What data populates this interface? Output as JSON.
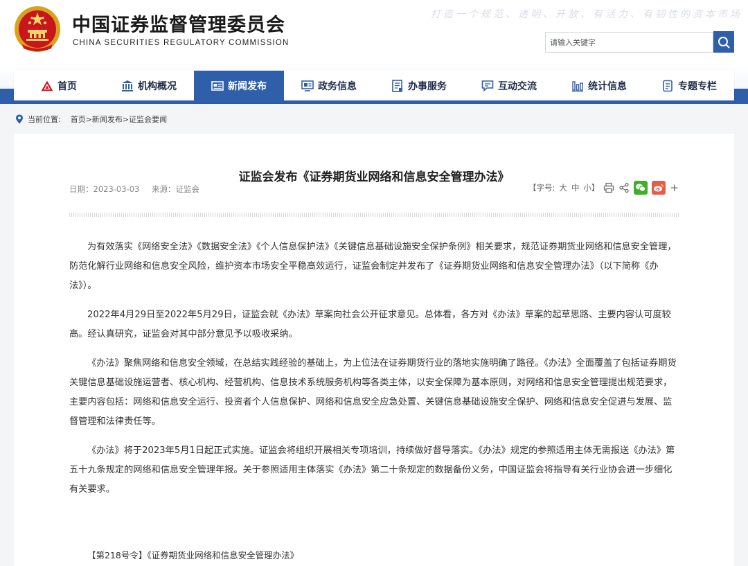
{
  "header": {
    "title_cn": "中国证券监督管理委员会",
    "title_en": "CHINA SECURITIES REGULATORY COMMISSION",
    "slogan": "打造一个规范、透明、开放、有活力、有韧性的资本市场",
    "search_placeholder": "请输入关键字",
    "brand_color": "#2e5fa8"
  },
  "nav": {
    "items": [
      {
        "label": "首页",
        "icon": "home-logo-icon"
      },
      {
        "label": "机构概况",
        "icon": "building-icon"
      },
      {
        "label": "新闻发布",
        "icon": "newspaper-icon",
        "active": true
      },
      {
        "label": "政务信息",
        "icon": "monitor-icon"
      },
      {
        "label": "办事服务",
        "icon": "document-list-icon"
      },
      {
        "label": "互动交流",
        "icon": "chat-icon"
      },
      {
        "label": "统计信息",
        "icon": "bar-chart-icon"
      },
      {
        "label": "专题专栏",
        "icon": "column-doc-icon"
      }
    ]
  },
  "breadcrumb": {
    "label": "当前位置:",
    "path": "首页>新闻发布>证监会要闻"
  },
  "article": {
    "title": "证监会发布《证券期货业网络和信息安全管理办法》",
    "date": "日期：2023-03-03",
    "source": "来源：证监会",
    "font_label": "【字号:",
    "font_large": "大",
    "font_medium": "中",
    "font_small": "小】",
    "paragraphs": [
      "为有效落实《网络安全法》《数据安全法》《个人信息保护法》《关键信息基础设施安全保护条例》相关要求，规范证券期货业网络和信息安全管理，防范化解行业网络和信息安全风险，维护资本市场安全平稳高效运行，证监会制定并发布了《证券期货业网络和信息安全管理办法》（以下简称《办法》）。",
      "2022年4月29日至2022年5月29日，证监会就《办法》草案向社会公开征求意见。总体看，各方对《办法》草案的起草思路、主要内容认可度较高。经认真研究，证监会对其中部分意见予以吸收采纳。",
      "《办法》聚焦网络和信息安全领域，在总结实践经验的基础上，为上位法在证券期货行业的落地实施明确了路径。《办法》全面覆盖了包括证券期货关键信息基础设施运营者、核心机构、经营机构、信息技术系统服务机构等各类主体，以安全保障为基本原则，对网络和信息安全管理提出规范要求，主要内容包括：网络和信息安全运行、投资者个人信息保护、网络和信息安全应急处置、关键信息基础设施安全保护、网络和信息安全促进与发展、监督管理和法律责任等。",
      "《办法》将于2023年5月1日起正式实施。证监会将组织开展相关专项培训，持续做好督导落实。《办法》规定的参照适用主体无需报送《办法》第五十九条规定的网络和信息安全管理年报。关于参照适用主体落实《办法》第二十条规定的数据备份义务，中国证监会将指导有关行业协会进一步细化有关要求。"
    ],
    "attachment": "【第218号令】《证券期货业网络和信息安全管理办法》"
  }
}
